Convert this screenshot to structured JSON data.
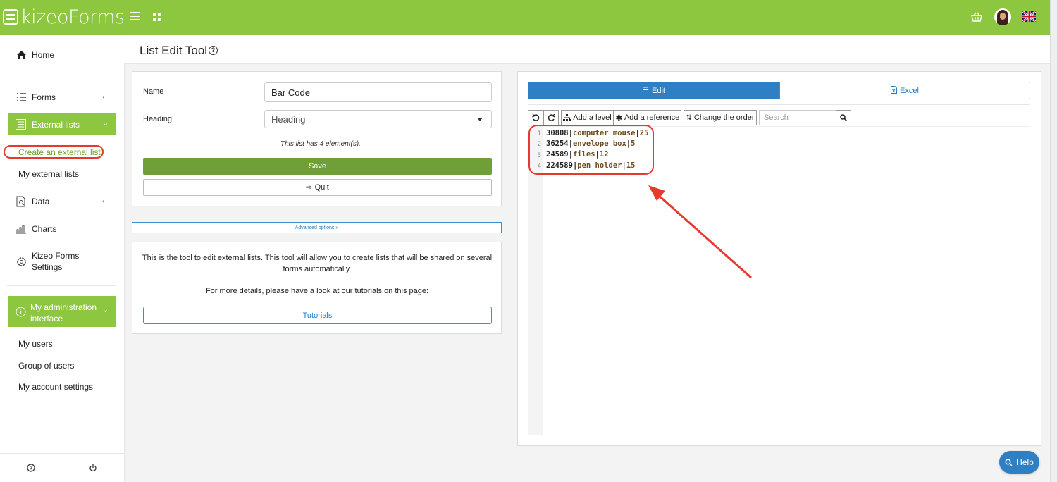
{
  "app": {
    "logo_text": "kizeoForms"
  },
  "sidebar": {
    "home": "Home",
    "forms": "Forms",
    "external_lists": "External lists",
    "create_external_list": "Create an external list",
    "my_external_lists": "My external lists",
    "data": "Data",
    "charts": "Charts",
    "settings_line1": "Kizeo Forms",
    "settings_line2": "Settings",
    "admin_line1": "My administration",
    "admin_line2": "interface",
    "my_users": "My users",
    "group_of_users": "Group of users",
    "my_account_settings": "My account settings"
  },
  "page": {
    "title": "List Edit Tool"
  },
  "form": {
    "name_label": "Name",
    "name_value": "Bar Code",
    "heading_label": "Heading",
    "heading_value": "Heading",
    "element_count_text": "This list has 4 element(s).",
    "save_label": "Save",
    "quit_label": "Quit",
    "advanced_options": "Advanced options »",
    "description_1": "This is the tool to edit external lists. This tool will allow you to create lists that will be shared on several forms automatically.",
    "description_2": "For more details, please have a look at our tutorials on this page:",
    "tutorials_label": "Tutorials"
  },
  "editor": {
    "tab_edit": "Edit",
    "tab_excel": "Excel",
    "add_level": "Add a level",
    "add_reference": "Add a reference",
    "change_order": "Change the order",
    "search_placeholder": "Search",
    "lines": [
      {
        "num": "1",
        "code": "30808",
        "sep1": "|",
        "name": "computer mouse",
        "sep2": "|",
        "qty": "25"
      },
      {
        "num": "2",
        "code": "36254",
        "sep1": "|",
        "name": "envelope box",
        "sep2": "|",
        "qty": "5"
      },
      {
        "num": "3",
        "code": "24589",
        "sep1": "|",
        "name": "files",
        "sep2": "|",
        "qty": "12"
      },
      {
        "num": "4",
        "code": "224589",
        "sep1": "|",
        "name": "pen holder",
        "sep2": "|",
        "qty": "15"
      }
    ]
  },
  "help_button": "Help",
  "colors": {
    "brand_green": "#8dc63f",
    "accent_blue": "#2f7fc4",
    "annotation_red": "#e53a2e"
  }
}
